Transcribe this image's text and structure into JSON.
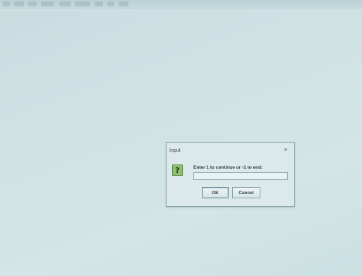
{
  "dialog": {
    "title": "Input",
    "close_symbol": "×",
    "icon": "question-icon",
    "prompt": "Enter 1 to continue or -1 to end:",
    "input_value": "",
    "ok_label": "OK",
    "cancel_label": "Cancel"
  },
  "colors": {
    "background": "#cfe2e4",
    "dialog_bg": "#dce9ea",
    "icon_green": "#8fbf6f"
  }
}
